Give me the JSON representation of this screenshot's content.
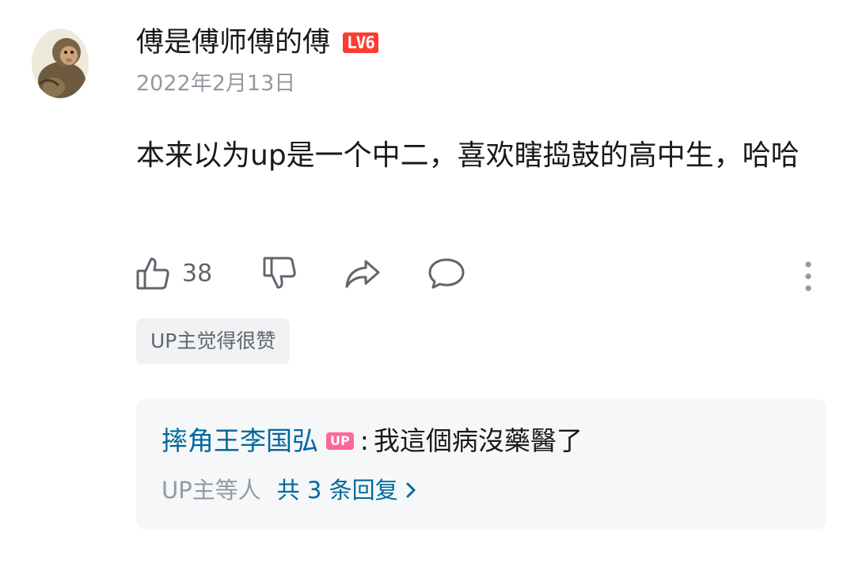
{
  "comment": {
    "user": {
      "name": "傅是傅师傅的傅",
      "level": "LV6",
      "avatar_icon": "monkey-avatar-icon"
    },
    "date": "2022年2月13日",
    "text": "本来以为up是一个中二，喜欢瞎捣鼓的高中生，哈哈",
    "actions": {
      "like_icon": "thumbs-up-icon",
      "like_count": "38",
      "dislike_icon": "thumbs-down-icon",
      "share_icon": "share-icon",
      "reply_icon": "comment-bubble-icon",
      "more_icon": "more-vertical-icon"
    },
    "tag": "UP主觉得很赞"
  },
  "reply_preview": {
    "author": "摔角王李国弘",
    "badge": "UP",
    "separator": ":",
    "text": "我這個病沒藥醫了",
    "summary_who": "UP主等人",
    "summary_count": "共 3 条回复",
    "chevron": "›"
  },
  "colors": {
    "text_primary": "#18191c",
    "text_secondary": "#9499a0",
    "action_gray": "#61666d",
    "link_blue": "#00699d",
    "level_badge": "#ff3b30",
    "up_badge": "#ff6699",
    "tag_bg": "#f1f2f3",
    "reply_bg": "#f6f7f8"
  }
}
